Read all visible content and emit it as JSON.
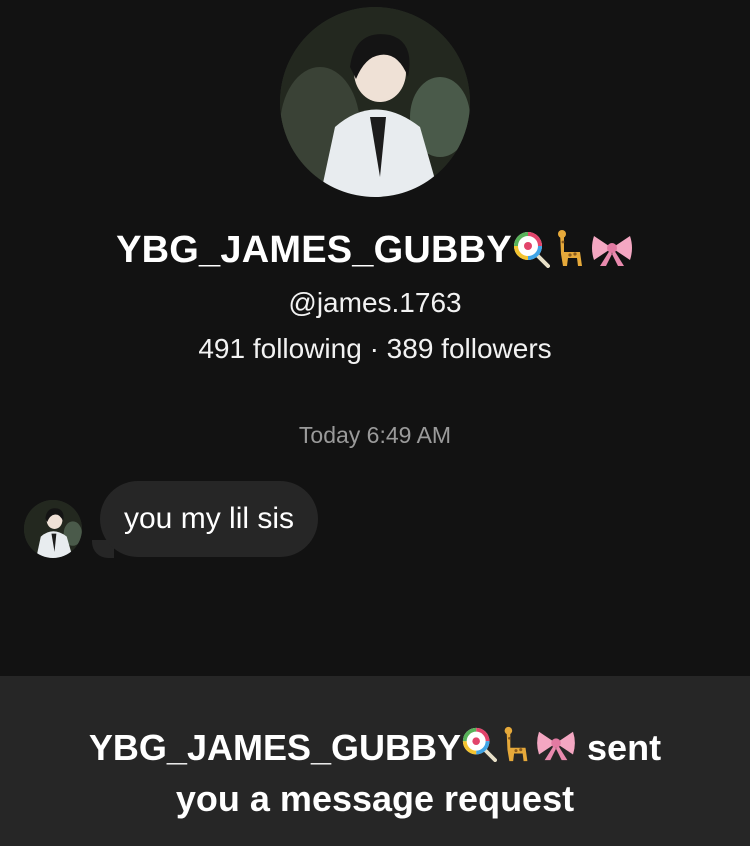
{
  "profile": {
    "display_name": "YBG_JAMES_GUBBY",
    "name_emojis": [
      "lollipop-icon",
      "giraffe-icon",
      "ribbon-icon"
    ],
    "handle": "@james.1763",
    "stats": "491 following · 389 followers"
  },
  "conversation": {
    "timestamp": "Today 6:49 AM",
    "messages": [
      {
        "text": "you my lil sis"
      }
    ]
  },
  "request_banner": {
    "sender": "YBG_JAMES_GUBBY",
    "action": "sent",
    "message": "you a message request"
  },
  "colors": {
    "background": "#121212",
    "bubble": "#262626",
    "muted_text": "#9a9a9a"
  }
}
